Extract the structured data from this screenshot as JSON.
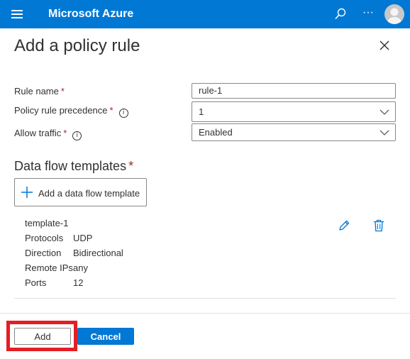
{
  "topbar": {
    "brand": "Microsoft Azure",
    "menu_icon": "hamburger-icon",
    "search_icon": "search-icon",
    "more_label": "···",
    "avatar_icon": "user-avatar-icon",
    "background": "#0078d4"
  },
  "panel": {
    "title": "Add a policy rule",
    "close_icon": "close-icon"
  },
  "form": {
    "rule_name": {
      "label": "Rule name",
      "required_mark": "*",
      "value": "rule-1"
    },
    "precedence": {
      "label": "Policy rule precedence",
      "required_mark": "*",
      "info": "i",
      "value": "1"
    },
    "allow_traffic": {
      "label": "Allow traffic",
      "required_mark": "*",
      "info": "i",
      "value": "Enabled"
    }
  },
  "templates": {
    "title": "Data flow templates",
    "required_mark": "*",
    "add_button": "Add a data flow template",
    "items": [
      {
        "name": "template-1",
        "rows": [
          {
            "key": "Protocols",
            "value": "UDP"
          },
          {
            "key": "Direction",
            "value": "Bidirectional"
          },
          {
            "key": "Remote IPs",
            "value": "any"
          },
          {
            "key": "Ports",
            "value": "12"
          }
        ]
      }
    ]
  },
  "footer": {
    "add_label": "Add",
    "cancel_label": "Cancel",
    "highlight_color": "#e31e24"
  }
}
